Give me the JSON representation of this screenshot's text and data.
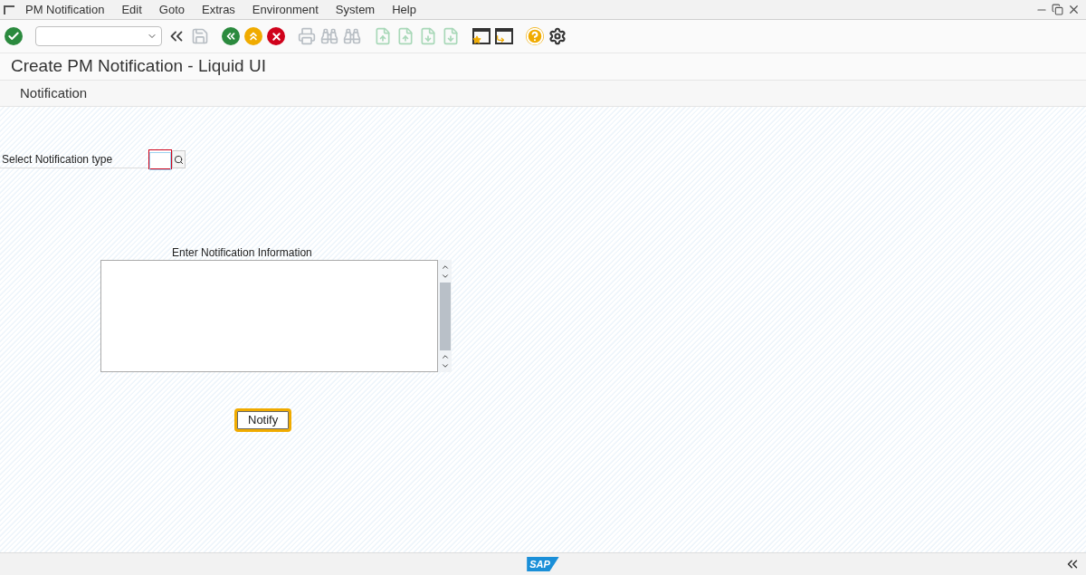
{
  "menu": [
    "PM Notification",
    "Edit",
    "Goto",
    "Extras",
    "Environment",
    "System",
    "Help"
  ],
  "toolbar": [
    {
      "kind": "enter",
      "disabled": false
    },
    {
      "kind": "command",
      "disabled": false
    },
    {
      "kind": "collapse",
      "disabled": false
    },
    {
      "kind": "save",
      "disabled": true
    },
    {
      "kind": "back",
      "disabled": false
    },
    {
      "kind": "exit",
      "disabled": false
    },
    {
      "kind": "cancel",
      "disabled": false
    },
    {
      "kind": "print",
      "disabled": true
    },
    {
      "kind": "find",
      "disabled": true
    },
    {
      "kind": "find-next",
      "disabled": true
    },
    {
      "kind": "first-page",
      "disabled": true
    },
    {
      "kind": "previous-page",
      "disabled": true
    },
    {
      "kind": "next-page",
      "disabled": true
    },
    {
      "kind": "last-page",
      "disabled": true
    },
    {
      "kind": "new-session",
      "disabled": false
    },
    {
      "kind": "shortcut",
      "disabled": false
    },
    {
      "kind": "help",
      "disabled": false
    },
    {
      "kind": "settings",
      "disabled": false
    }
  ],
  "title": "Create PM Notification - Liquid UI",
  "section": "Notification",
  "notification_type": {
    "label": "Select Notification type",
    "required": true
  },
  "info": {
    "label": "Enter Notification Information"
  },
  "notify_button": {
    "label": "Notify",
    "focused": true
  },
  "status_bar": {
    "logo": "SAP"
  }
}
